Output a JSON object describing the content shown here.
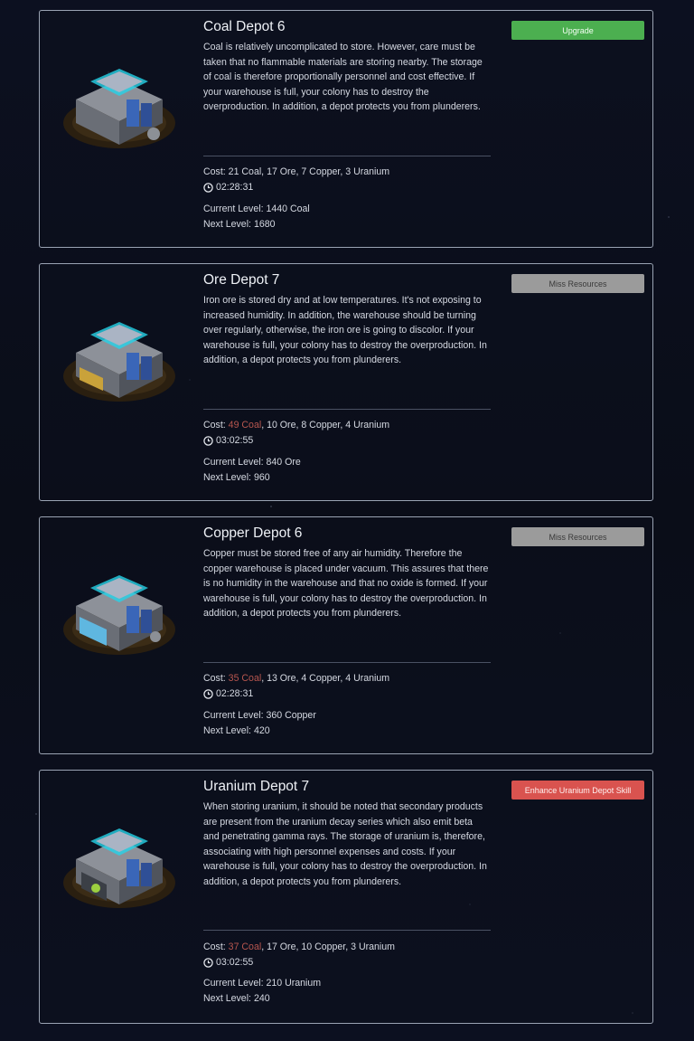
{
  "depots": [
    {
      "title": "Coal Depot 6",
      "description": "Coal is relatively uncomplicated to store. However, care must be taken that no flammable materials are storing nearby. The storage of coal is therefore proportionally personnel and cost effective. If your warehouse is full, your colony has to destroy the overproduction. In addition, a depot protects you from plunderers.",
      "cost_label": "Cost: ",
      "cost_short": "",
      "cost_rest": "21 Coal, 17 Ore, 7 Copper, 3 Uranium",
      "time": "02:28:31",
      "current_level": "Current Level: 1440 Coal",
      "next_level": "Next Level: 1680",
      "button_label": "Upgrade",
      "button_style": "green",
      "theme_color": "#7c7f86"
    },
    {
      "title": "Ore Depot 7",
      "description": "Iron ore is stored dry and at low temperatures. It's not exposing to increased humidity. In addition, the warehouse should be turning over regularly, otherwise, the iron ore is going to discolor. If your warehouse is full, your colony has to destroy the overproduction. In addition, a depot protects you from plunderers.",
      "cost_label": "Cost: ",
      "cost_short": "49 Coal",
      "cost_rest": ", 10 Ore, 8 Copper, 4 Uranium",
      "time": "03:02:55",
      "current_level": "Current Level: 840 Ore",
      "next_level": "Next Level: 960",
      "button_label": "Miss Resources",
      "button_style": "grey",
      "theme_color": "#c9a23a"
    },
    {
      "title": "Copper Depot 6",
      "description": "Copper must be stored free of any air humidity. Therefore the copper warehouse is placed under vacuum. This assures that there is no humidity in the warehouse and that no oxide is formed. If your warehouse is full, your colony has to destroy the overproduction. In addition, a depot protects you from plunderers.",
      "cost_label": "Cost: ",
      "cost_short": "35 Coal",
      "cost_rest": ", 13 Ore, 4 Copper, 4 Uranium",
      "time": "02:28:31",
      "current_level": "Current Level: 360 Copper",
      "next_level": "Next Level: 420",
      "button_label": "Miss Resources",
      "button_style": "grey",
      "theme_color": "#5fb7e0"
    },
    {
      "title": "Uranium Depot 7",
      "description": "When storing uranium, it should be noted that secondary products are present from the uranium decay series which also emit beta and penetrating gamma rays. The storage of uranium is, therefore, associating with high personnel expenses and costs. If your warehouse is full, your colony has to destroy the overproduction. In addition, a depot protects you from plunderers.",
      "cost_label": "Cost: ",
      "cost_short": "37 Coal",
      "cost_rest": ", 17 Ore, 10 Copper, 3 Uranium",
      "time": "03:02:55",
      "current_level": "Current Level: 210 Uranium",
      "next_level": "Next Level: 240",
      "button_label": "Enhance Uranium Depot Skill",
      "button_style": "red",
      "theme_color": "#9ccf3f"
    }
  ]
}
